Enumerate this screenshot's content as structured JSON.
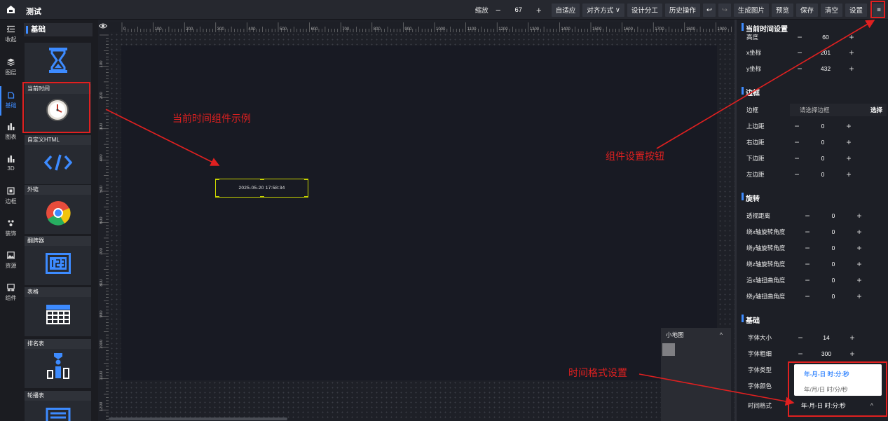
{
  "app": {
    "title": "测试"
  },
  "toolbar": {
    "zoom_label": "缩放",
    "zoom_minus": "−",
    "zoom_value": "67",
    "zoom_plus": "+",
    "adapt": "自适应",
    "align": "对齐方式",
    "align_chevron": "∨",
    "design": "设计分工",
    "history": "历史操作",
    "undo": "↩",
    "redo": "↪",
    "gen_image": "生成图片",
    "preview": "预览",
    "save": "保存",
    "clear": "清空",
    "settings": "设置",
    "menu_icon": "≡"
  },
  "leftnav": [
    {
      "label": "收起",
      "icon": "collapse-icon"
    },
    {
      "label": "图层",
      "icon": "layers-icon"
    },
    {
      "label": "基础",
      "icon": "basic-icon"
    },
    {
      "label": "图表",
      "icon": "chart-icon"
    },
    {
      "label": "3D",
      "icon": "3d-icon"
    },
    {
      "label": "边框",
      "icon": "border-icon"
    },
    {
      "label": "装饰",
      "icon": "decoration-icon"
    },
    {
      "label": "资源",
      "icon": "resource-icon"
    },
    {
      "label": "组件",
      "icon": "component-icon"
    }
  ],
  "panel": {
    "title": "基础",
    "cards": [
      {
        "label": "",
        "icon": "hourglass-icon"
      },
      {
        "label": "当前时间",
        "icon": "clock-icon"
      },
      {
        "label": "自定义HTML",
        "icon": "code-icon"
      },
      {
        "label": "外链",
        "icon": "chrome-icon"
      },
      {
        "label": "翻牌器",
        "icon": "flip-counter-icon"
      },
      {
        "label": "表格",
        "icon": "table-icon"
      },
      {
        "label": "排名表",
        "icon": "ranking-icon"
      },
      {
        "label": "轮播表",
        "icon": "carousel-icon"
      }
    ]
  },
  "ruler": {
    "ticks": [
      "0",
      "100",
      "200",
      "300",
      "400",
      "500",
      "600",
      "700",
      "800",
      "900",
      "1000",
      "1100",
      "1200",
      "1300",
      "1400",
      "1500",
      "1600",
      "1700",
      "1800",
      "1900"
    ],
    "vticks": [
      "100",
      "200",
      "300",
      "400",
      "500",
      "600",
      "700",
      "800",
      "900",
      "1000",
      "1100",
      "1200"
    ]
  },
  "canvas": {
    "clock_text": "2025-05-20 17:58:34"
  },
  "minimap": {
    "title": "小地图",
    "caret": "^"
  },
  "rightpanel": {
    "header": "当前时间设置",
    "pos_height_label": "高度",
    "pos_height_value": "60",
    "x_label": "x坐标",
    "x_value": "201",
    "y_label": "y坐标",
    "y_value": "432",
    "border_section": "边框",
    "border_label": "边框",
    "border_placeholder": "请选择边框",
    "border_select": "选择",
    "margin_top_label": "上边距",
    "margin_top_value": "0",
    "margin_right_label": "右边距",
    "margin_right_value": "0",
    "margin_bottom_label": "下边距",
    "margin_bottom_value": "0",
    "margin_left_label": "左边距",
    "margin_left_value": "0",
    "rotate_section": "旋转",
    "persp_label": "透视距离",
    "persp_value": "0",
    "rx_label": "绕x轴旋转角度",
    "rx_value": "0",
    "ry_label": "绕y轴旋转角度",
    "ry_value": "0",
    "rz_label": "绕z轴旋转角度",
    "rz_value": "0",
    "skx_label": "沿x轴扭曲角度",
    "skx_value": "0",
    "sky_label": "绕y轴扭曲角度",
    "sky_value": "0",
    "basic_section": "基础",
    "font_size_label": "字体大小",
    "font_size_value": "14",
    "font_weight_label": "字体粗细",
    "font_weight_value": "300",
    "font_type_label": "字体类型",
    "font_color_label": "字体颜色",
    "time_format_label": "时间格式",
    "time_format_value": "年-月-日 时:分:秒",
    "time_format_caret": "^",
    "options": [
      "年-月-日 时:分:秒",
      "年/月/日 时/分/秒"
    ]
  },
  "annotations": {
    "clock_example": "当前时间组件示例",
    "settings_button": "组件设置按钮",
    "time_format": "时间格式设置"
  },
  "colors": {
    "accent": "#3d8bff",
    "annotation": "#e02020",
    "selection": "#c8d400"
  }
}
